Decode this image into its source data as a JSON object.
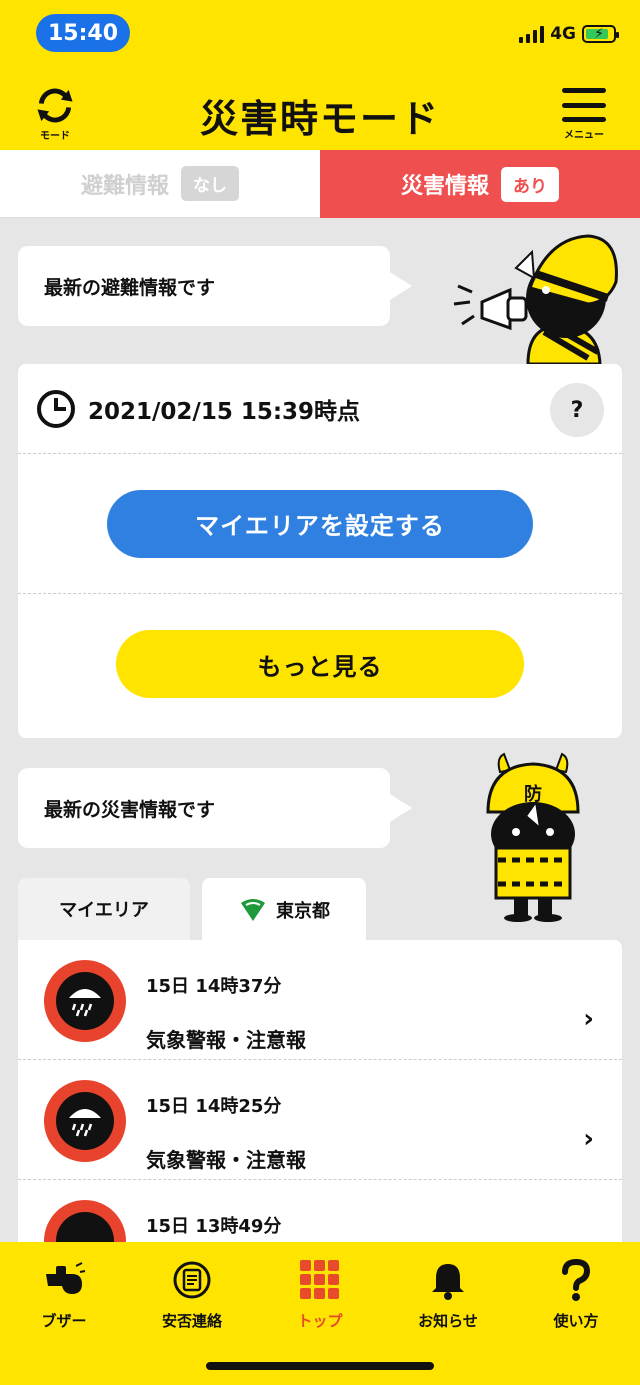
{
  "status_bar": {
    "time": "15:40",
    "network": "4G"
  },
  "header": {
    "mode_label": "モード",
    "title": "災害時モード",
    "menu_label": "メニュー"
  },
  "top_tabs": {
    "evac": {
      "label": "避難情報",
      "badge": "なし"
    },
    "disaster": {
      "label": "災害情報",
      "badge": "あり"
    }
  },
  "evac_section": {
    "bubble": "最新の避難情報です",
    "timestamp": "2021/02/15 15:39時点",
    "help": "?",
    "set_area_button": "マイエリアを設定する",
    "more_button": "もっと見る"
  },
  "disaster_section": {
    "bubble": "最新の災害情報です",
    "mascot_helmet_text": "防",
    "tabs": [
      {
        "label": "マイエリア"
      },
      {
        "label": "東京都"
      }
    ],
    "items": [
      {
        "date": "15日 14時37分",
        "kind": "気象警報・注意報"
      },
      {
        "date": "15日 14時25分",
        "kind": "気象警報・注意報"
      },
      {
        "date": "15日 13時49分",
        "kind": ""
      }
    ]
  },
  "bottom_nav": [
    {
      "label": "ブザー",
      "icon": "whistle-icon"
    },
    {
      "label": "安否連絡",
      "icon": "safety-check-icon"
    },
    {
      "label": "トップ",
      "icon": "grid-icon"
    },
    {
      "label": "お知らせ",
      "icon": "bell-icon"
    },
    {
      "label": "使い方",
      "icon": "question-icon"
    }
  ],
  "colors": {
    "brand_yellow": "#ffe400",
    "alert_red": "#ef4f4f",
    "action_blue": "#2f80e1",
    "active_nav": "#e84a2c"
  }
}
